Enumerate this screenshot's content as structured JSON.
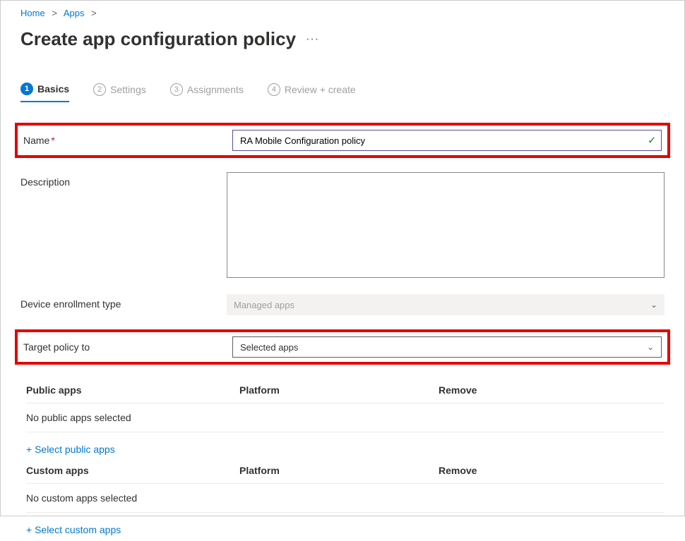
{
  "breadcrumb": {
    "items": [
      {
        "label": "Home"
      },
      {
        "label": "Apps"
      }
    ]
  },
  "page_title": "Create app configuration policy",
  "more_label": "···",
  "steps": [
    {
      "num": "1",
      "label": "Basics",
      "active": true
    },
    {
      "num": "2",
      "label": "Settings",
      "active": false
    },
    {
      "num": "3",
      "label": "Assignments",
      "active": false
    },
    {
      "num": "4",
      "label": "Review + create",
      "active": false
    }
  ],
  "fields": {
    "name": {
      "label": "Name",
      "required": "*",
      "value": "RA Mobile Configuration policy"
    },
    "description": {
      "label": "Description",
      "value": ""
    },
    "enrollment_type": {
      "label": "Device enrollment type",
      "value": "Managed apps"
    },
    "target_policy": {
      "label": "Target policy to",
      "value": "Selected apps"
    }
  },
  "public_apps": {
    "headers": {
      "c1": "Public apps",
      "c2": "Platform",
      "c3": "Remove"
    },
    "empty": "No public apps selected",
    "link": "+ Select public apps"
  },
  "custom_apps": {
    "headers": {
      "c1": "Custom apps",
      "c2": "Platform",
      "c3": "Remove"
    },
    "empty": "No custom apps selected",
    "link": "+ Select custom apps"
  }
}
